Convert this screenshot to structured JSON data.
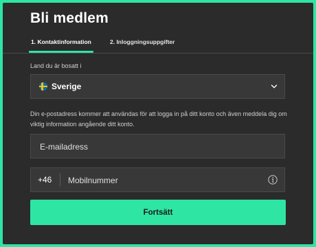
{
  "title": "Bli medlem",
  "tabs": [
    {
      "label": "1. Kontaktinformation",
      "active": true
    },
    {
      "label": "2. Inloggningsuppgifter",
      "active": false
    }
  ],
  "country": {
    "label": "Land du är bosatt i",
    "selected": "Sverige",
    "flag_icon": "sweden-flag-icon"
  },
  "email_help": "Din e-postadress kommer att användas för att logga in på ditt konto och även meddela dig om viktig information angående ditt konto.",
  "email": {
    "placeholder": "E-mailadress",
    "value": ""
  },
  "phone": {
    "prefix": "+46",
    "placeholder": "Mobilnummer",
    "value": "",
    "info_icon": "info-icon"
  },
  "continue_label": "Fortsätt",
  "colors": {
    "accent": "#2ee5a4",
    "background": "#2b2b2b",
    "field_background": "#383838",
    "text": "#ffffff"
  }
}
